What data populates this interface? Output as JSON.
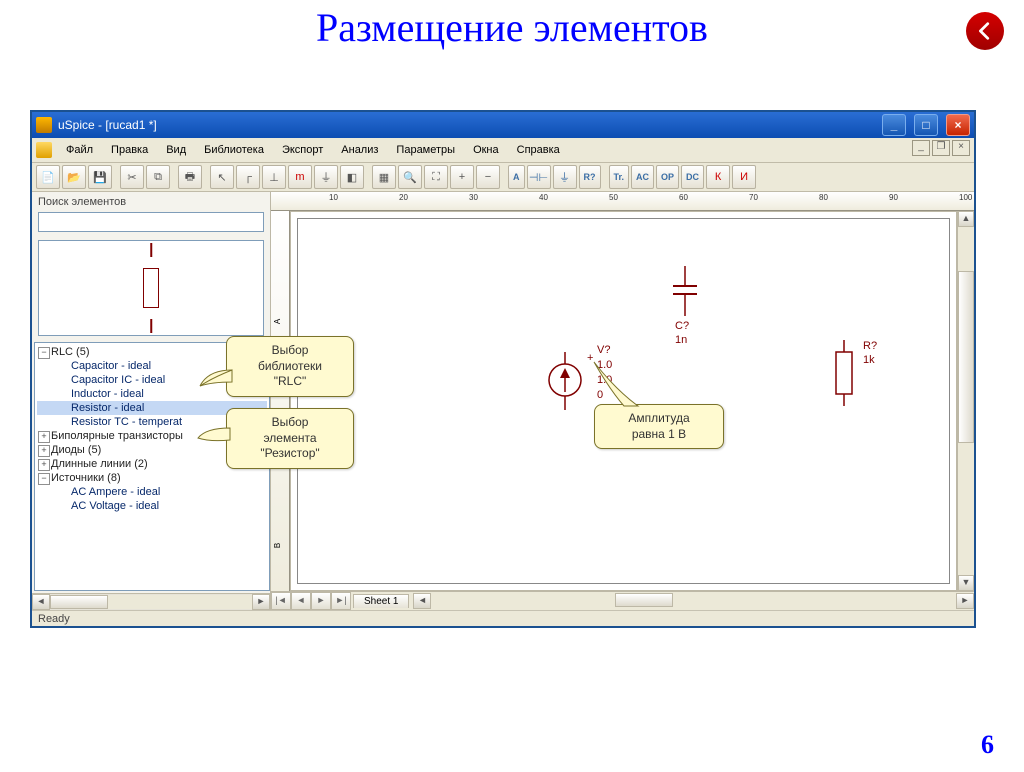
{
  "slide": {
    "title": "Размещение элементов",
    "page_number": "6"
  },
  "window": {
    "title": "uSpice - [rucad1 *]",
    "status": "Ready",
    "menu": [
      "Файл",
      "Правка",
      "Вид",
      "Библиотека",
      "Экспорт",
      "Анализ",
      "Параметры",
      "Окна",
      "Справка"
    ],
    "ruler": [
      "10",
      "20",
      "30",
      "40",
      "50",
      "60",
      "70",
      "80",
      "90",
      "100"
    ]
  },
  "panel": {
    "search_label": "Поиск элементов"
  },
  "tree": {
    "root": "RLC (5)",
    "rlc": [
      "Capacitor - ideal",
      "Capacitor IC - ideal",
      "Inductor - ideal",
      "Resistor - ideal",
      "Resistor TC - temperat"
    ],
    "others": [
      "Биполярные транзисторы",
      "Диоды (5)",
      "Длинные линии (2)",
      "Источники (8)"
    ],
    "sources": [
      "AC Ampere - ideal",
      "AC Voltage - ideal"
    ]
  },
  "canvas": {
    "sheet_tab": "Sheet 1",
    "source": {
      "ref": "V?",
      "v1": "1.0",
      "v2": "1.0",
      "v3": "0"
    },
    "cap": {
      "ref": "C?",
      "val": "1n"
    },
    "res": {
      "ref": "R?",
      "val": "1k"
    }
  },
  "callouts": {
    "lib": "Выбор\nбиблиотеки\n\"RLC\"",
    "elem": "Выбор\nэлемента\n\"Резистор\"",
    "amp": "Амплитуда\nравна 1 В"
  },
  "toolbar2_text": [
    "A",
    "R?",
    "Tr.",
    "AC",
    "OP",
    "DC"
  ]
}
